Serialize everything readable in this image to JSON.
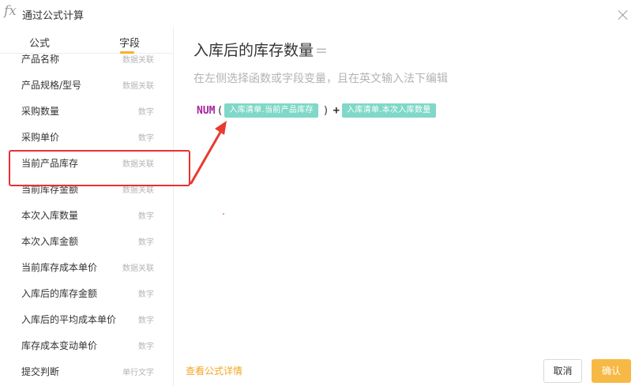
{
  "dialog": {
    "icon_text": "fx",
    "title": "通过公式计算"
  },
  "tabs": [
    {
      "label": "公式"
    },
    {
      "label": "字段"
    }
  ],
  "fields": [
    {
      "name": "产品名称",
      "type": "数据关联"
    },
    {
      "name": "产品规格/型号",
      "type": "数据关联"
    },
    {
      "name": "采购数量",
      "type": "数字"
    },
    {
      "name": "采购单价",
      "type": "数字"
    },
    {
      "name": "当前产品库存",
      "type": "数据关联"
    },
    {
      "name": "当前库存金额",
      "type": "数据关联"
    },
    {
      "name": "本次入库数量",
      "type": "数字"
    },
    {
      "name": "本次入库金额",
      "type": "数字"
    },
    {
      "name": "当前库存成本单价",
      "type": "数据关联"
    },
    {
      "name": "入库后的库存金额",
      "type": "数字"
    },
    {
      "name": "入库后的平均成本单价",
      "type": "数字"
    },
    {
      "name": "库存成本变动单价",
      "type": "数字"
    },
    {
      "name": "提交判断",
      "type": "单行文字"
    }
  ],
  "editor": {
    "title": "入库后的库存数量",
    "equals": "=",
    "hint": "在左侧选择函数或字段变量，且在英文输入法下编辑",
    "formula": {
      "function": "NUM",
      "open_paren": "(",
      "close_paren": ")",
      "operator": "+",
      "tag1": "入库清单.当前产品库存",
      "tag2": "入库清单.本次入库数量"
    }
  },
  "footer": {
    "detail_link": "查看公式详情",
    "cancel": "取消",
    "confirm": "确认"
  },
  "colors": {
    "accent": "#f5b32a",
    "tag_bg": "#7fd8c8",
    "function_color": "#a6229b",
    "annotation_red": "#e83030"
  }
}
